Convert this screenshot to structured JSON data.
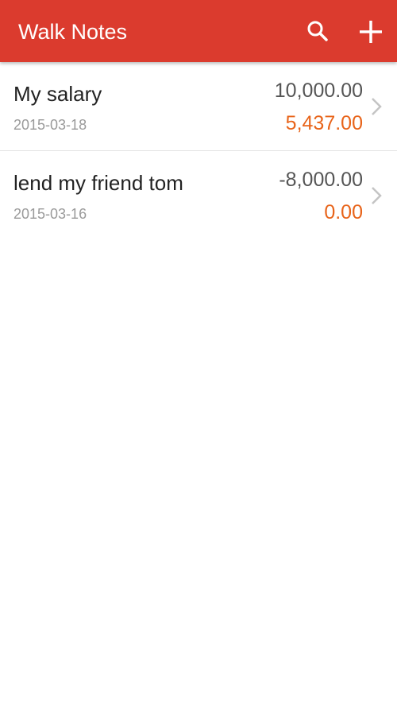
{
  "colors": {
    "appbar": "#db3b2e",
    "title_text": "#ffffff",
    "amount_text": "#555555",
    "balance_text": "#e8641a",
    "date_text": "#9a9a9a",
    "chevron": "#c4c4c4",
    "divider": "#e3e3e3"
  },
  "appbar": {
    "title": "Walk Notes",
    "actions": [
      {
        "name": "search",
        "icon": "search-icon"
      },
      {
        "name": "add",
        "icon": "plus-icon"
      }
    ]
  },
  "notes": [
    {
      "title": "My salary",
      "date": "2015-03-18",
      "amount": "10,000.00",
      "balance": "5,437.00"
    },
    {
      "title": "lend my friend tom",
      "date": "2015-03-16",
      "amount": "-8,000.00",
      "balance": "0.00"
    }
  ]
}
